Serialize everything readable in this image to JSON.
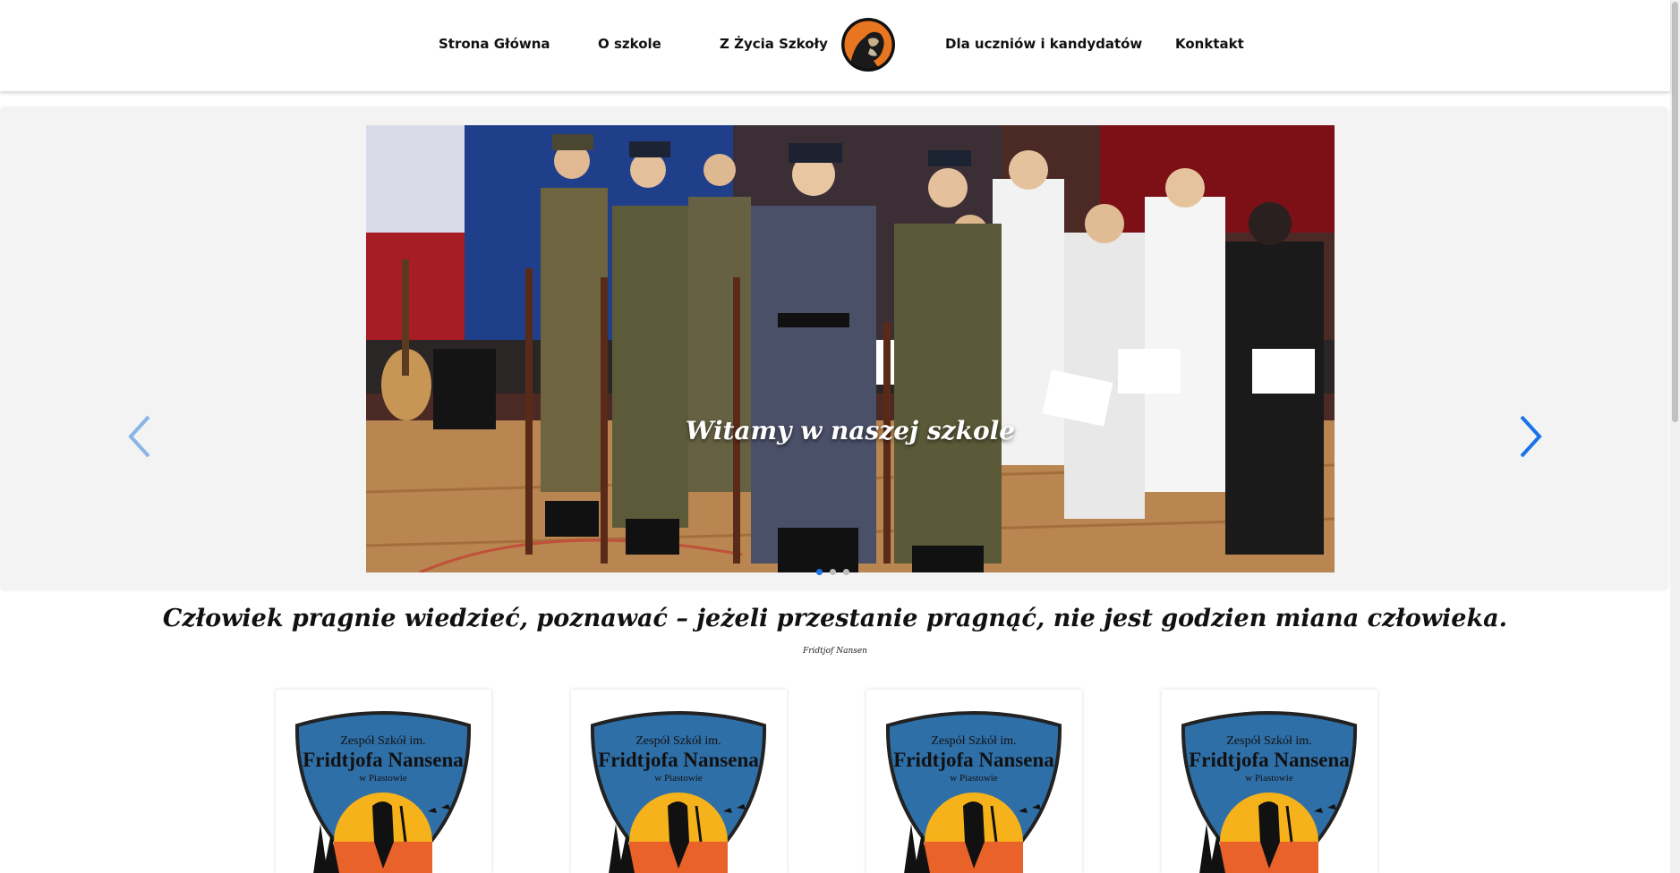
{
  "nav": {
    "items": [
      {
        "label": "Strona Główna"
      },
      {
        "label": "O szkole"
      },
      {
        "label": "Z Życia Szkoły"
      },
      {
        "label": "Dla uczniów i kandydatów"
      },
      {
        "label": "Konktakt"
      }
    ],
    "logo_icon": "nansen-portrait-logo"
  },
  "hero": {
    "caption": "Witamy w naszej szkole",
    "prev_icon": "chevron-left-icon",
    "next_icon": "chevron-right-icon",
    "slide_count": 3,
    "active_slide": 1,
    "accent_color": "#1a73e8"
  },
  "quote": {
    "text": "Człowiek pragnie wiedzieć, poznawać – jeżeli przestanie pragnąć, nie jest godzien miana człowieka.",
    "author": "Fridtjof Nansen"
  },
  "cards": [
    {
      "line1": "Zespół Szkół im.",
      "line2": "Fridtjofa Nansena",
      "line3": "w Piastowie"
    },
    {
      "line1": "Zespół Szkół im.",
      "line2": "Fridtjofa Nansena",
      "line3": "w Piastowie"
    },
    {
      "line1": "Zespół Szkół im.",
      "line2": "Fridtjofa Nansena",
      "line3": "w Piastowie"
    },
    {
      "line1": "Zespół Szkół im.",
      "line2": "Fridtjofa Nansena",
      "line3": "w Piastowie"
    }
  ],
  "colors": {
    "shield_blue": "#2f6fa8",
    "sun_yellow": "#f5b21b",
    "sun_orange": "#e8622a"
  }
}
